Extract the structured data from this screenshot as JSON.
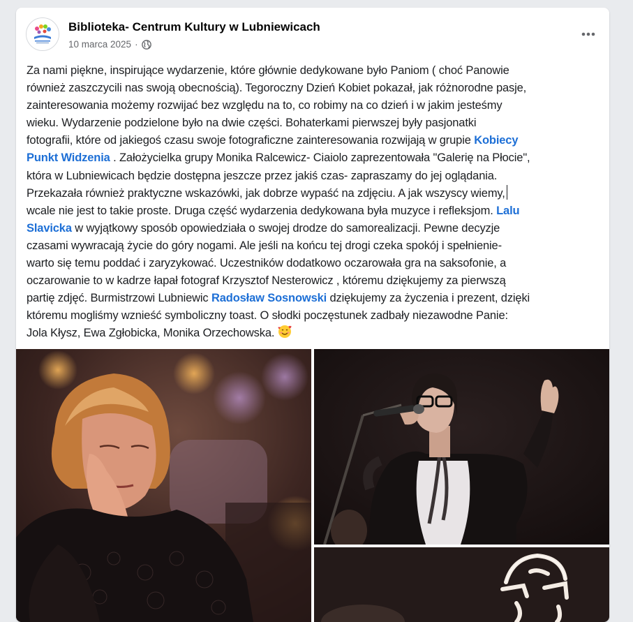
{
  "post": {
    "page_name": "Biblioteka- Centrum Kultury w Lubniewicach",
    "date": "10 marca 2025",
    "separator": "·",
    "privacy_icon": "globe-icon",
    "more_icon": "more-options-icon",
    "avatar_icon": "library-logo-icon",
    "body": {
      "l1": "Za nami piękne, inspirujące wydarzenie, które głównie dedykowane było Paniom ( choć Panowie",
      "l2": "również zaszczycili nas swoją obecnością). Tegoroczny Dzień Kobiet pokazał, jak różnorodne pasje,",
      "l3": "zainteresowania możemy rozwijać bez względu na to, co robimy na co dzień i w jakim jesteśmy",
      "l4": "wieku. Wydarzenie podzielone było na dwie części. Bohaterkami pierwszej były pasjonatki",
      "l5": "fotografii, które od jakiegoś czasu swoje fotograficzne zainteresowania rozwijają w grupie",
      "l5_link": "Kobiecy",
      "l6_link": "Punkt Widzenia",
      "l6": " . Założycielka grupy Monika Ralcewicz- Ciaiolo zaprezentowała \"Galerię na Płocie\",",
      "l7": "która w Lubniewicach będzie dostępna jeszcze przez jakiś czas- zapraszamy do jej oglądania.",
      "l8": "Przekazała również praktyczne wskazówki, jak dobrze wypaść na zdjęciu. A jak wszyscy wiemy,",
      "l9": "wcale nie jest to takie proste. Druga część wydarzenia dedykowana była muzyce i refleksjom.",
      "l9_link": "Lalu",
      "l10_link": "Slavicka",
      "l10": " w wyjątkowy sposób opowiedziała o swojej drodze do samorealizacji. Pewne decyzje",
      "l11": "czasami wywracają życie do góry nogami. Ale jeśli na końcu tej drogi czeka spokój i spełnienie-",
      "l12": "warto się temu poddać i zaryzykować. Uczestników dodatkowo oczarowała gra na saksofonie, a",
      "l13": "oczarowanie to w kadrze łapał fotograf  Krzysztof Nesterowicz ,  któremu dziękujemy za pierwszą",
      "l14": "partię zdjęć.  Burmistrzowi Lubniewic",
      "l14_link": "Radosław Sosnowski",
      "l14_end": " dziękujemy za życzenia i prezent, dzięki",
      "l15": "któremu mogliśmy wznieść symboliczny toast. O słodki poczęstunek zadbały niezawodne Panie:",
      "l16": "Jola Kłysz, Ewa Zgłobicka, Monika Orzechowska.",
      "emoji": "smiling-face-with-hearts-icon"
    },
    "photos": [
      {
        "name": "photo-woman-resting-head"
      },
      {
        "name": "photo-singer-with-microphone"
      },
      {
        "name": "photo-neon-sign"
      }
    ]
  }
}
